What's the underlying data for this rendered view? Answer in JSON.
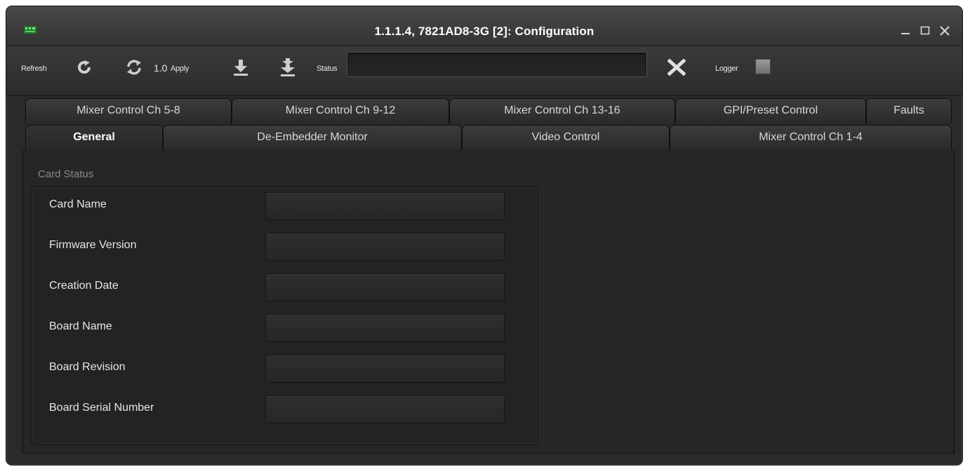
{
  "window": {
    "title": "1.1.1.4, 7821AD8-3G  [2]: Configuration",
    "app_icon": "card-icon",
    "controls": [
      {
        "name": "minimize-button",
        "glyph": "_"
      },
      {
        "name": "maximize-button",
        "glyph": "☐"
      },
      {
        "name": "close-button",
        "glyph": "✕"
      }
    ]
  },
  "toolbar": {
    "refresh_label": "Refresh",
    "apply_value": "1.0",
    "apply_label": "Apply",
    "status_label": "Status",
    "status_value": "",
    "logger_label": "Logger",
    "icons": [
      "refresh-icon",
      "auto-refresh-icon",
      "download-icon",
      "download-all-icon",
      "clear-status-icon",
      "logger-icon"
    ]
  },
  "tabs": {
    "row1": [
      {
        "label": "Mixer Control Ch 5-8"
      },
      {
        "label": "Mixer Control Ch 9-12"
      },
      {
        "label": "Mixer Control Ch 13-16"
      },
      {
        "label": "GPI/Preset Control"
      },
      {
        "label": "Faults"
      }
    ],
    "row2": [
      {
        "label": "General",
        "active": true
      },
      {
        "label": "De-Embedder Monitor"
      },
      {
        "label": "Video Control"
      },
      {
        "label": "Mixer Control Ch 1-4"
      }
    ]
  },
  "card_status": {
    "group_label": "Card Status",
    "fields": [
      {
        "label": "Card Name",
        "value": ""
      },
      {
        "label": "Firmware Version",
        "value": ""
      },
      {
        "label": "Creation Date",
        "value": ""
      },
      {
        "label": "Board Name",
        "value": ""
      },
      {
        "label": "Board Revision",
        "value": ""
      },
      {
        "label": "Board Serial Number",
        "value": ""
      }
    ]
  },
  "colors": {
    "background": "#2a2a2a",
    "title_text": "#ffffff",
    "label_text": "#e6e6e6",
    "group_label": "#8a8a8a",
    "icon_green": "#2ea043"
  }
}
